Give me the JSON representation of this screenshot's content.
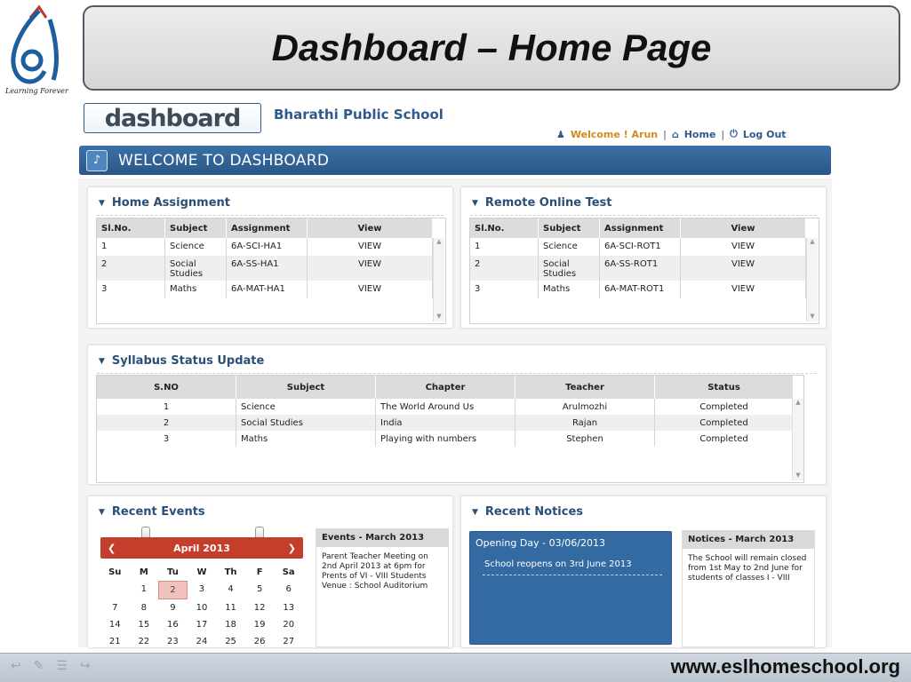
{
  "slide": {
    "title": "Dashboard – Home Page",
    "logo_tagline": "Learning Forever",
    "footer_url": "www.eslhomeschool.org"
  },
  "app": {
    "logo_text": "dashboard",
    "school_name": "Bharathi Public School",
    "welcome_user": "Welcome ! Arun",
    "home_label": "Home",
    "logout_label": "Log Out",
    "banner": "WELCOME TO DASHBOARD"
  },
  "home_assignment": {
    "title": "Home Assignment",
    "columns": [
      "Sl.No.",
      "Subject",
      "Assignment",
      "View"
    ],
    "rows": [
      [
        "1",
        "Science",
        "6A-SCI-HA1",
        "VIEW"
      ],
      [
        "2",
        "Social Studies",
        "6A-SS-HA1",
        "VIEW"
      ],
      [
        "3",
        "Maths",
        "6A-MAT-HA1",
        "VIEW"
      ]
    ]
  },
  "remote_test": {
    "title": "Remote Online Test",
    "columns": [
      "Sl.No.",
      "Subject",
      "Assignment",
      "View"
    ],
    "rows": [
      [
        "1",
        "Science",
        "6A-SCI-ROT1",
        "VIEW"
      ],
      [
        "2",
        "Social Studies",
        "6A-SS-ROT1",
        "VIEW"
      ],
      [
        "3",
        "Maths",
        "6A-MAT-ROT1",
        "VIEW"
      ]
    ]
  },
  "syllabus": {
    "title": "Syllabus Status Update",
    "columns": [
      "S.NO",
      "Subject",
      "Chapter",
      "Teacher",
      "Status"
    ],
    "rows": [
      [
        "1",
        "Science",
        "The World Around Us",
        "Arulmozhi",
        "Completed"
      ],
      [
        "2",
        "Social Studies",
        "India",
        "Rajan",
        "Completed"
      ],
      [
        "3",
        "Maths",
        "Playing with numbers",
        "Stephen",
        "Completed"
      ]
    ]
  },
  "events": {
    "title": "Recent Events",
    "calendar_month": "April 2013",
    "weekdays": [
      "Su",
      "M",
      "Tu",
      "W",
      "Th",
      "F",
      "Sa"
    ],
    "days": [
      "",
      "1",
      "2",
      "3",
      "4",
      "5",
      "6",
      "7",
      "8",
      "9",
      "10",
      "11",
      "12",
      "13",
      "14",
      "15",
      "16",
      "17",
      "18",
      "19",
      "20",
      "21",
      "22",
      "23",
      "24",
      "25",
      "26",
      "27"
    ],
    "highlight_day": "2",
    "box_title": "Events - March 2013",
    "box_text": "Parent Teacher Meeting on 2nd April 2013 at 6pm for Prents of VI - VIII Students Venue : School Auditorium"
  },
  "notices": {
    "title": "Recent Notices",
    "opening_title": "Opening Day - 03/06/2013",
    "opening_text": "School reopens on 3rd June 2013",
    "box_title": "Notices - March 2013",
    "box_text": "The School will remain closed from 1st May to 2nd June for students of classes I - VIII"
  },
  "colors": {
    "accent": "#2f5a8a",
    "banner": "#3b6fa6",
    "calendar_header": "#c53d2b",
    "notice_blue": "#336aa2"
  }
}
